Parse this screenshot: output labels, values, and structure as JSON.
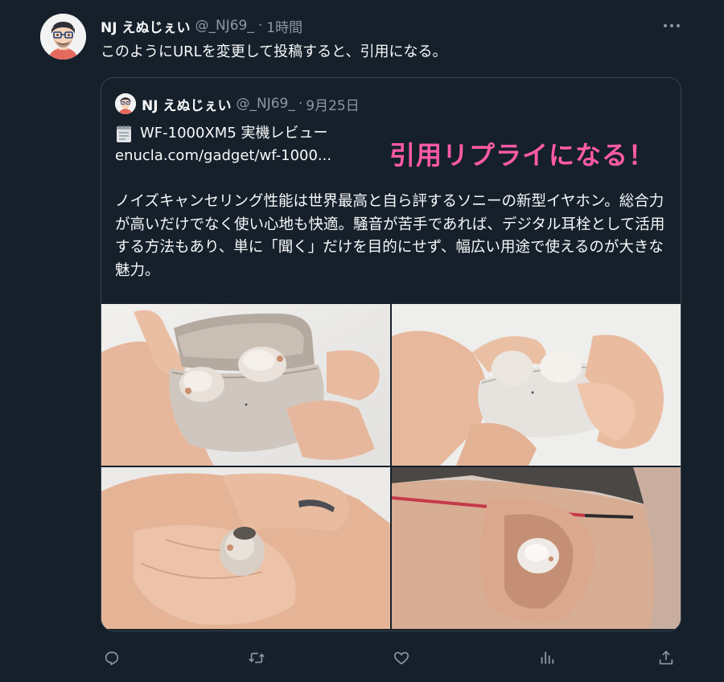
{
  "tweet": {
    "author_name": "NJ えぬじぇい",
    "author_handle": "@_NJ69_",
    "separator": "·",
    "timestamp": "1時間",
    "text": "このようにURLを変更して投稿すると、引用になる。",
    "more_icon": "more-horizontal-icon"
  },
  "quote": {
    "author_name": "NJ えぬじぇい",
    "author_handle": "@_NJ69_",
    "separator": "·",
    "date": "9月25日",
    "link_title": "WF-1000XM5 実機レビュー",
    "link_icon": "memo-icon",
    "url": "enucla.com/gadget/wf-1000...",
    "body": "ノイズキャンセリング性能は世界最高と自ら評するソニーの新型イヤホン。総合力が高いだけでなく使い心地も快適。騒音が苦手であれば、デジタル耳栓として活用する方法もあり、単に「聞く」だけを目的にせず、幅広い用途で使えるのが大きな魅力。"
  },
  "annotation": {
    "text": "引用リプライになる！",
    "color": "#ff5aa6"
  },
  "media": [
    {
      "icon": "photo-open-case-with-earbuds"
    },
    {
      "icon": "photo-taking-earbud-from-case"
    },
    {
      "icon": "photo-earbud-on-palm"
    },
    {
      "icon": "photo-earbud-in-ear"
    }
  ],
  "actions": [
    {
      "name": "reply",
      "icon": "reply-icon"
    },
    {
      "name": "retweet",
      "icon": "retweet-icon"
    },
    {
      "name": "like",
      "icon": "heart-icon"
    },
    {
      "name": "views",
      "icon": "analytics-icon"
    },
    {
      "name": "share",
      "icon": "share-icon"
    }
  ],
  "colors": {
    "background": "#15202b",
    "text": "#f7f9f9",
    "secondary_text": "#8b98a5",
    "border": "#38444d"
  }
}
